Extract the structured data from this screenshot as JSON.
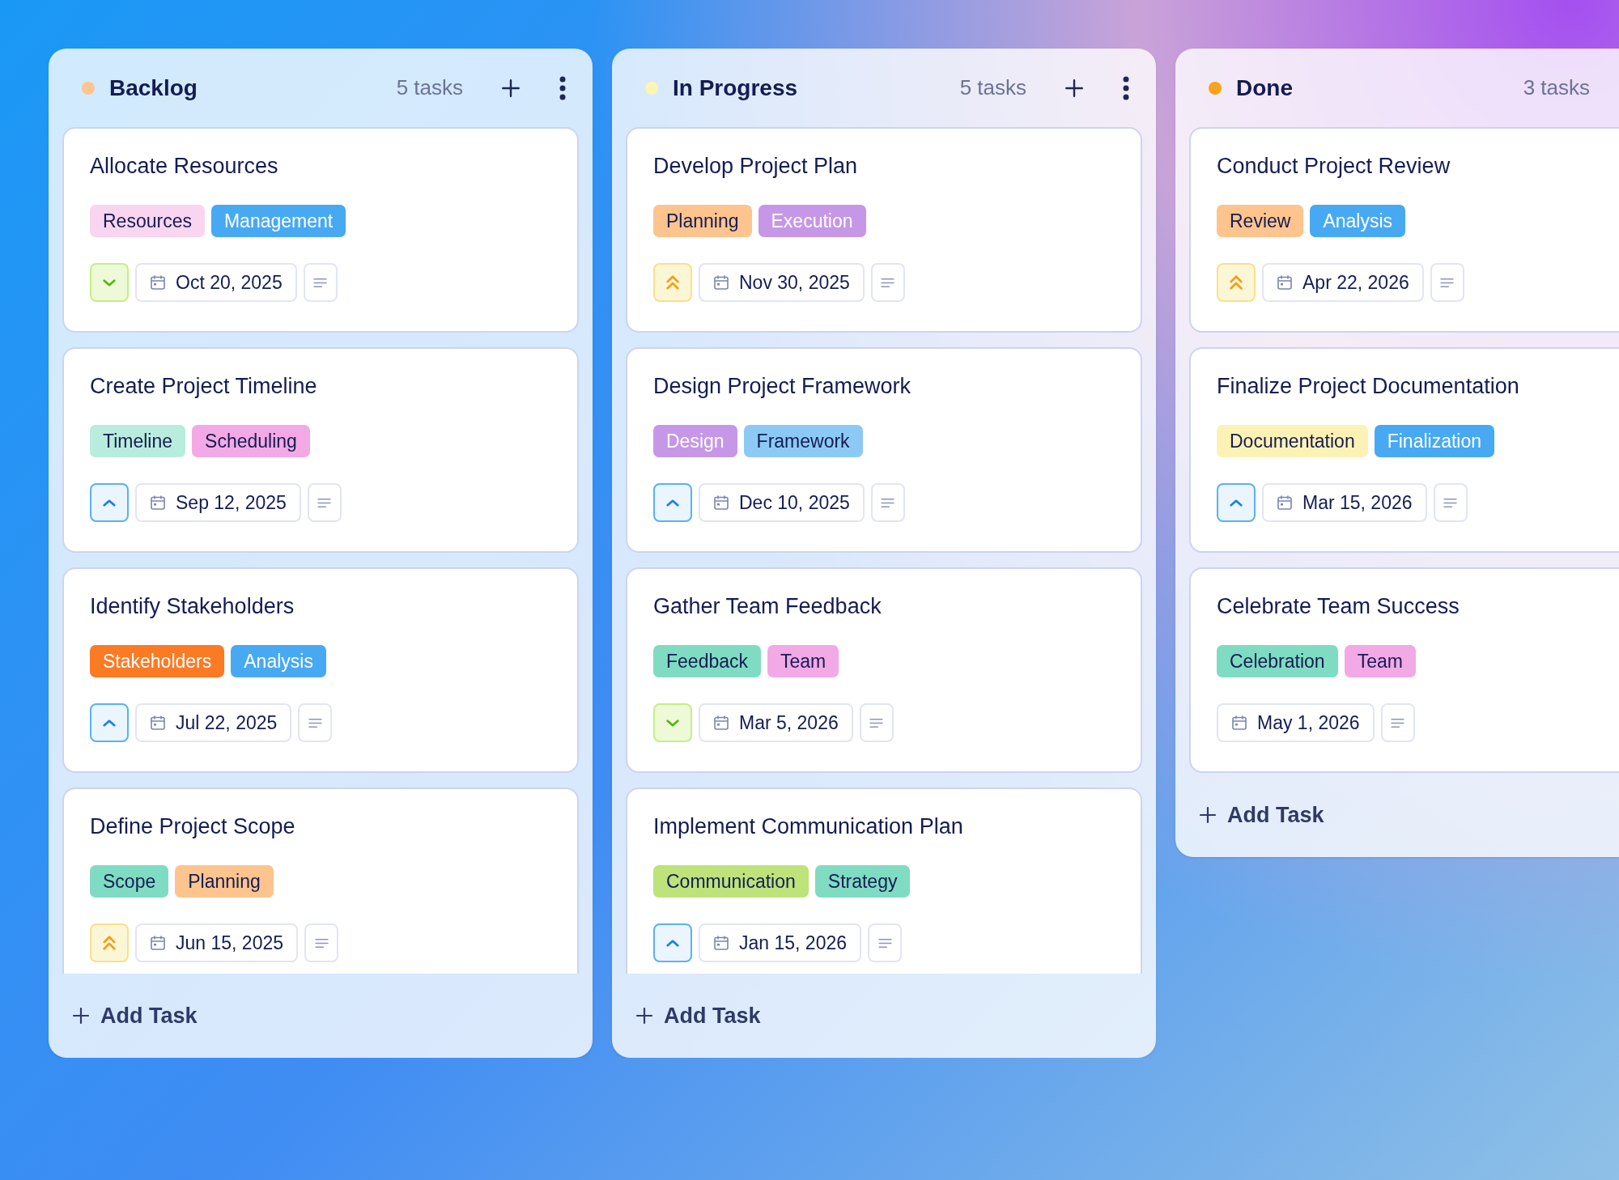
{
  "columns": [
    {
      "title": "Backlog",
      "color": "#fdc48e",
      "count": "5 tasks",
      "add_task": "Add Task",
      "cards": [
        {
          "title": "Allocate Resources",
          "tags": [
            {
              "label": "Resources",
              "color": "#f9d5f0"
            },
            {
              "label": "Management",
              "color": "#47a9f2"
            }
          ],
          "priority": {
            "kind": "low"
          },
          "date": "Oct 20, 2025"
        },
        {
          "title": "Create Project Timeline",
          "tags": [
            {
              "label": "Timeline",
              "color": "#b8ecdc"
            },
            {
              "label": "Scheduling",
              "color": "#f3a9e6"
            }
          ],
          "priority": {
            "kind": "medium"
          },
          "date": "Sep 12, 2025"
        },
        {
          "title": "Identify Stakeholders",
          "tags": [
            {
              "label": "Stakeholders",
              "color": "#fb7a24"
            },
            {
              "label": "Analysis",
              "color": "#47a9f2"
            }
          ],
          "priority": {
            "kind": "medium"
          },
          "date": "Jul 22, 2025"
        },
        {
          "title": "Define Project Scope",
          "tags": [
            {
              "label": "Scope",
              "color": "#7fdcc2"
            },
            {
              "label": "Planning",
              "color": "#fdc48e"
            }
          ],
          "priority": {
            "kind": "high"
          },
          "date": "Jun 15, 2025"
        }
      ]
    },
    {
      "title": "In Progress",
      "color": "#fdf5b0",
      "count": "5 tasks",
      "add_task": "Add Task",
      "cards": [
        {
          "title": "Develop Project Plan",
          "tags": [
            {
              "label": "Planning",
              "color": "#fdc48e"
            },
            {
              "label": "Execution",
              "color": "#c697e6"
            }
          ],
          "priority": {
            "kind": "high"
          },
          "date": "Nov 30, 2025"
        },
        {
          "title": "Design Project Framework",
          "tags": [
            {
              "label": "Design",
              "color": "#c697e6"
            },
            {
              "label": "Framework",
              "color": "#8ccaf5"
            }
          ],
          "priority": {
            "kind": "medium"
          },
          "date": "Dec 10, 2025"
        },
        {
          "title": "Gather Team Feedback",
          "tags": [
            {
              "label": "Feedback",
              "color": "#7fdcc2"
            },
            {
              "label": "Team",
              "color": "#f3a9e6"
            }
          ],
          "priority": {
            "kind": "low"
          },
          "date": "Mar 5, 2026"
        },
        {
          "title": "Implement Communication Plan",
          "tags": [
            {
              "label": "Communication",
              "color": "#bde37a"
            },
            {
              "label": "Strategy",
              "color": "#7fdcc2"
            }
          ],
          "priority": {
            "kind": "medium"
          },
          "date": "Jan 15, 2026"
        }
      ]
    },
    {
      "title": "Done",
      "color": "#f9a21b",
      "count": "3 tasks",
      "add_task": "Add Task",
      "cards": [
        {
          "title": "Conduct Project Review",
          "tags": [
            {
              "label": "Review",
              "color": "#fdc48e"
            },
            {
              "label": "Analysis",
              "color": "#47a9f2"
            }
          ],
          "priority": {
            "kind": "high"
          },
          "date": "Apr 22, 2026"
        },
        {
          "title": "Finalize Project Documentation",
          "tags": [
            {
              "label": "Documentation",
              "color": "#fdf2b5"
            },
            {
              "label": "Finalization",
              "color": "#47a9f2"
            }
          ],
          "priority": {
            "kind": "medium"
          },
          "date": "Mar 15, 2026"
        },
        {
          "title": "Celebrate Team Success",
          "tags": [
            {
              "label": "Celebration",
              "color": "#7fdcc2"
            },
            {
              "label": "Team",
              "color": "#f3a9e6"
            }
          ],
          "priority": {
            "kind": "none"
          },
          "date": "May 1, 2026"
        }
      ]
    }
  ]
}
